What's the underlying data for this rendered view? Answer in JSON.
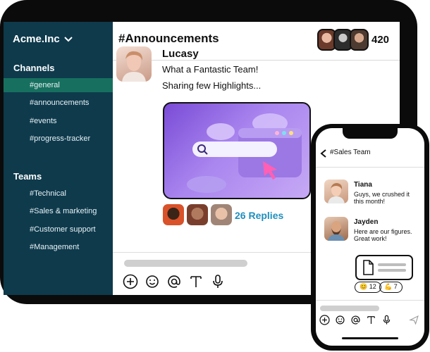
{
  "sidebar": {
    "workspace": "Acme.Inc",
    "channels_title": "Channels",
    "channels": [
      "#general",
      "#announcements",
      "#events",
      "#progress-tracker"
    ],
    "teams_title": "Teams",
    "teams": [
      "#Technical",
      "#Sales & marketing",
      "#Customer support",
      "#Management"
    ]
  },
  "header": {
    "channel": "#Announcements",
    "member_count": "420"
  },
  "message": {
    "author": "Lucasy",
    "line1": "What a Fantastic Team!",
    "line2": "Sharing few Highlights...",
    "replies": "26 Replies"
  },
  "phone": {
    "title": "#Sales Team",
    "messages": [
      {
        "name": "Tiana",
        "text": "Guys, we crushed it this month!"
      },
      {
        "name": "Jayden",
        "text": "Here are our figures. Great work!"
      }
    ],
    "reactions": [
      {
        "emoji": "😊",
        "count": "12"
      },
      {
        "emoji": "💪",
        "count": "7"
      }
    ]
  },
  "colors": {
    "sidebar_bg": "#0e3a4c",
    "active_item": "#17705f",
    "replies_link": "#1f8fbd",
    "hero_purple": "#7a4bd6"
  },
  "icons": [
    "chevron-down-icon",
    "plus-icon",
    "emoji-icon",
    "at-icon",
    "text-format-icon",
    "mic-icon",
    "back-arrow-icon",
    "file-icon",
    "send-icon",
    "search-icon",
    "cursor-icon"
  ]
}
